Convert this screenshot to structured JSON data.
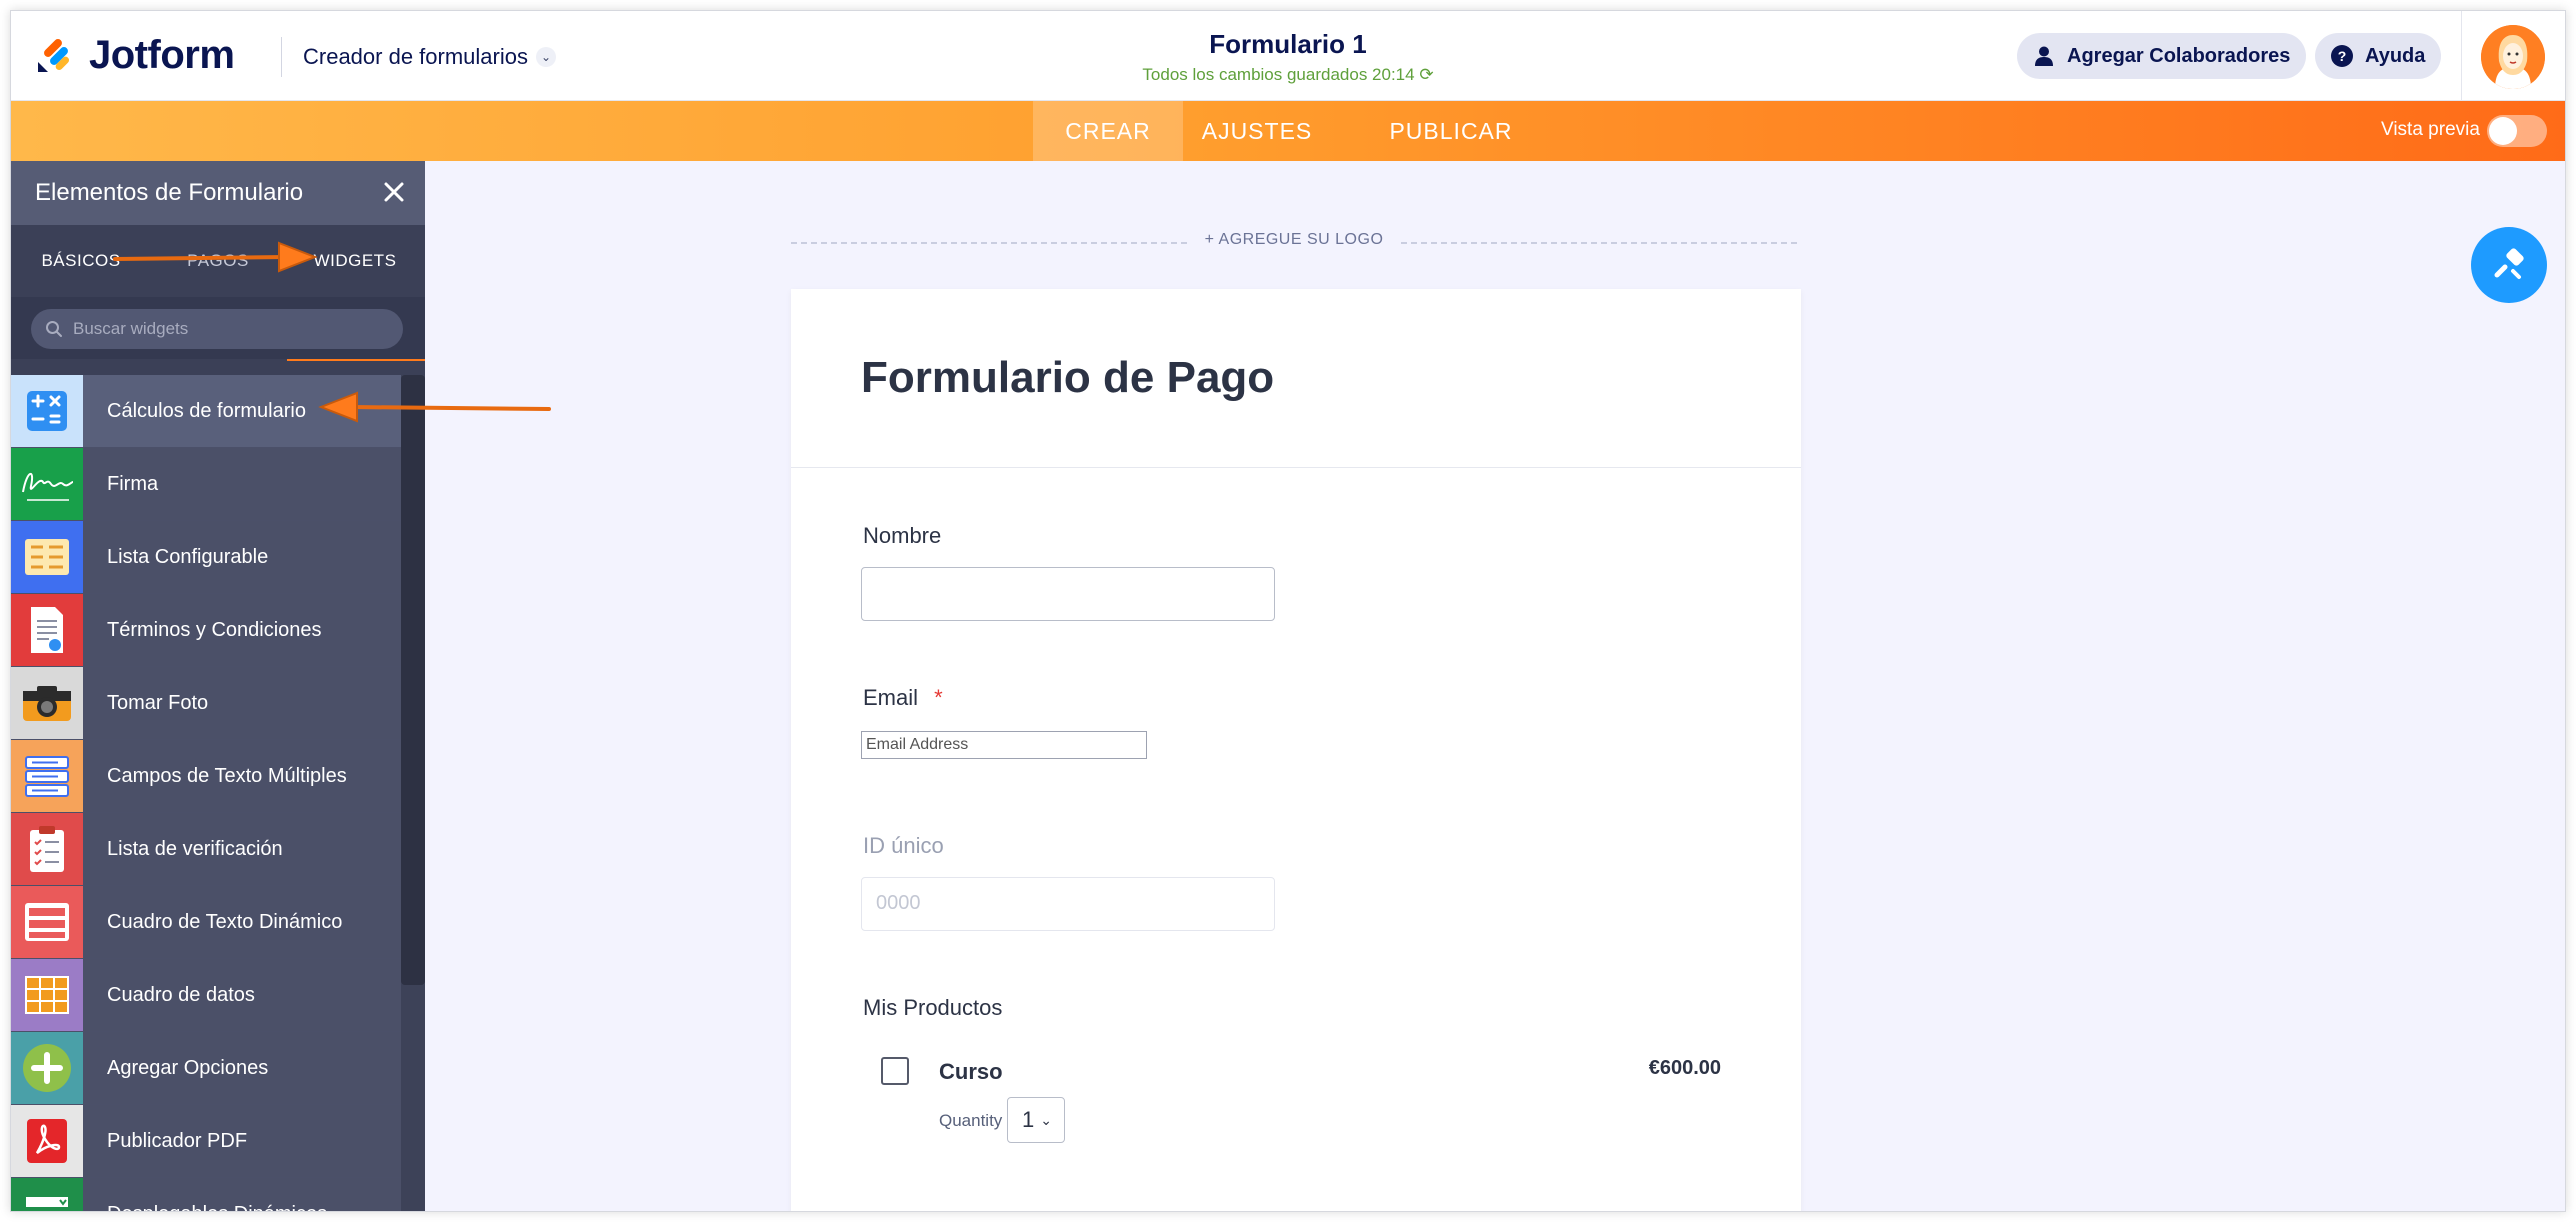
{
  "header": {
    "brand": "Jotform",
    "builder_menu": "Creador de formularios",
    "form_title": "Formulario 1",
    "save_status": "Todos los cambios guardados 20:14",
    "collaborators_button": "Agregar Colaboradores",
    "help_button": "Ayuda"
  },
  "nav": {
    "tabs": [
      {
        "label": "CREAR",
        "active": true
      },
      {
        "label": "AJUSTES",
        "active": false
      },
      {
        "label": "PUBLICAR",
        "active": false
      }
    ],
    "preview_label": "Vista previa",
    "preview_on": false
  },
  "panel": {
    "title": "Elementos de Formulario",
    "tabs": [
      {
        "label": "BÁSICOS"
      },
      {
        "label": "PAGOS"
      },
      {
        "label": "WIDGETS",
        "active": true
      }
    ],
    "search_placeholder": "Buscar widgets",
    "widgets": [
      {
        "label": "Cálculos de formulario",
        "icon": "calculator-icon",
        "color": "#2f8ff2"
      },
      {
        "label": "Firma",
        "icon": "signature-icon",
        "color": "#18a04a"
      },
      {
        "label": "Lista Configurable",
        "icon": "configurable-list-icon",
        "color": "#3f6ff0"
      },
      {
        "label": "Términos y Condiciones",
        "icon": "terms-document-icon",
        "color": "#e23c3c"
      },
      {
        "label": "Tomar Foto",
        "icon": "camera-icon",
        "color": "#d9d9d9"
      },
      {
        "label": "Campos de Texto Múltiples",
        "icon": "multiple-text-fields-icon",
        "color": "#f6a35a"
      },
      {
        "label": "Lista de verificación",
        "icon": "checklist-icon",
        "color": "#e04b4b"
      },
      {
        "label": "Cuadro de Texto Dinámico",
        "icon": "dynamic-textbox-icon",
        "color": "#ea5a5a"
      },
      {
        "label": "Cuadro de datos",
        "icon": "data-grid-icon",
        "color": "#9b7cc6"
      },
      {
        "label": "Agregar Opciones",
        "icon": "add-options-icon",
        "color": "#8fc04a"
      },
      {
        "label": "Publicador PDF",
        "icon": "pdf-icon",
        "color": "#e6e6e6"
      },
      {
        "label": "Desplegables Dinámicos",
        "icon": "dynamic-dropdowns-icon",
        "color": "#1f8f4a"
      }
    ]
  },
  "form": {
    "add_logo": "+ AGREGUE SU LOGO",
    "heading": "Formulario de Pago",
    "fields": {
      "name_label": "Nombre",
      "email_label": "Email",
      "email_required_mark": "*",
      "email_placeholder": "Email Address",
      "unique_id_label": "ID único",
      "unique_id_value": "0000",
      "products_label": "Mis Productos"
    },
    "product": {
      "name": "Curso",
      "price": "€600.00",
      "quantity_label": "Quantity",
      "quantity": "1"
    }
  },
  "colors": {
    "brand_navy": "#0a1551",
    "accent_orange": "#ff7b1c",
    "panel_bg": "#3b4057",
    "canvas_bg": "#f3f3fe",
    "save_green": "#5fa03b",
    "fab_blue": "#1e9bff"
  }
}
